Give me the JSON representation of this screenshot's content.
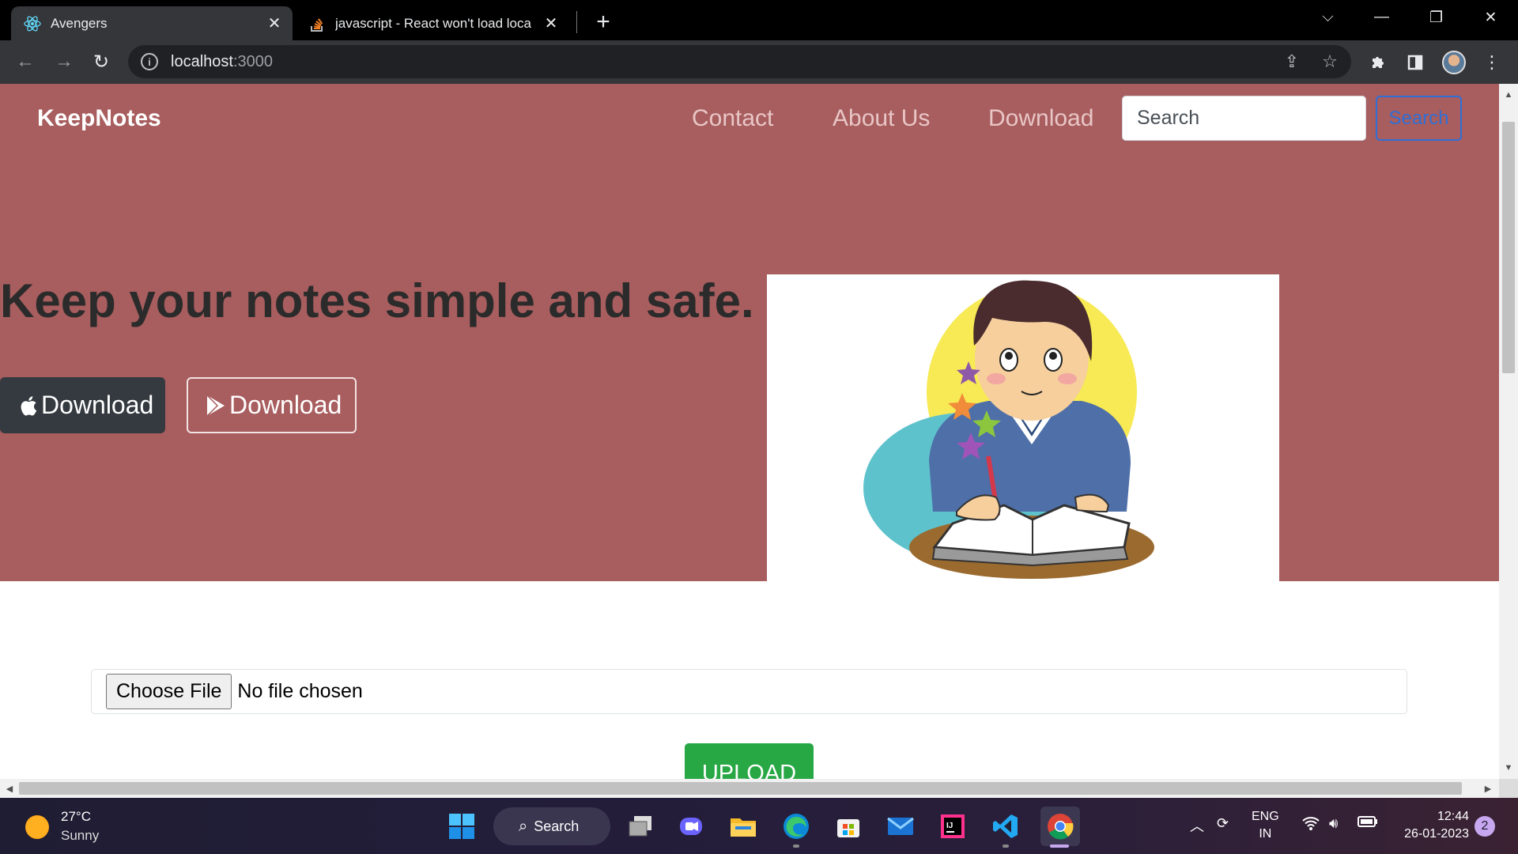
{
  "browser": {
    "tabs": [
      {
        "title": "Avengers",
        "active": true
      },
      {
        "title": "javascript - React won't load loca",
        "active": false
      }
    ],
    "address": {
      "host": "localhost",
      "port": ":3000"
    }
  },
  "site": {
    "brand": "KeepNotes",
    "nav": [
      "Contact",
      "About Us",
      "Download"
    ],
    "search_placeholder": "Search",
    "search_button": "Search",
    "headline": "Keep your notes simple and safe.",
    "download_apple": "Download",
    "download_play": "Download",
    "file_button": "Choose File",
    "file_status": "No file chosen",
    "upload": "UPLOAD"
  },
  "taskbar": {
    "temp": "27°C",
    "condition": "Sunny",
    "search_label": "Search",
    "lang_top": "ENG",
    "lang_bottom": "IN",
    "time": "12:44",
    "date": "26-01-2023",
    "notifications": "2"
  },
  "colors": {
    "hero": "#a85d5e",
    "upload": "#28a745",
    "search_outline": "#2f6fd6"
  }
}
